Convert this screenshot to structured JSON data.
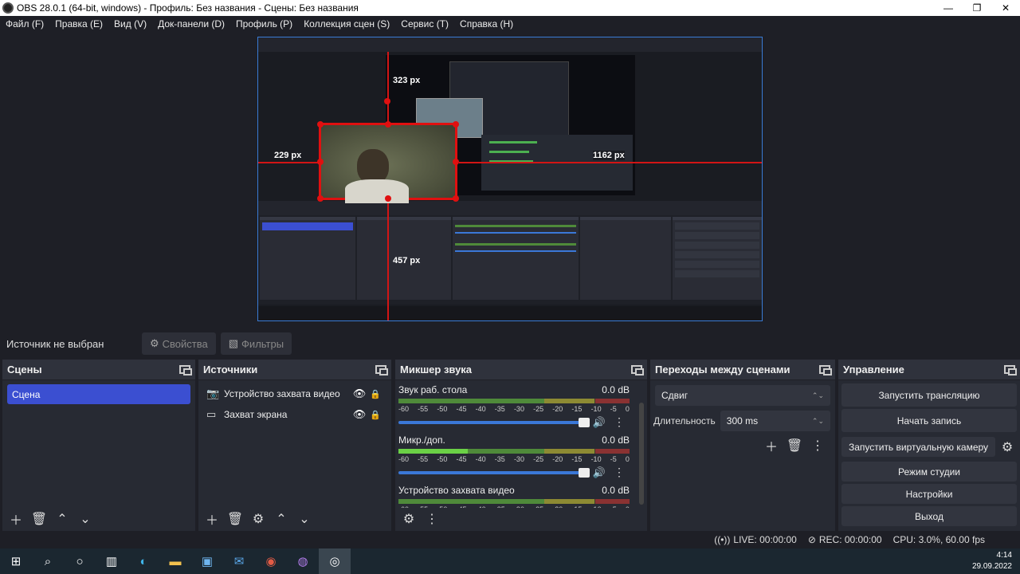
{
  "window": {
    "title": "OBS 28.0.1 (64-bit, windows) - Профиль: Без названия - Сцены: Без названия",
    "minimize": "—",
    "maximize": "❐",
    "close": "✕"
  },
  "menu": [
    "Файл (F)",
    "Правка (E)",
    "Вид (V)",
    "Док-панели (D)",
    "Профиль (P)",
    "Коллекция сцен (S)",
    "Сервис (T)",
    "Справка (H)"
  ],
  "preview": {
    "guides": {
      "top": "323 px",
      "left": "229 px",
      "right": "1162 px",
      "bottom": "457 px"
    }
  },
  "source_toolbar": {
    "no_source": "Источник не выбран",
    "properties": "Свойства",
    "filters": "Фильтры"
  },
  "scenes": {
    "title": "Сцены",
    "items": [
      "Сцена"
    ]
  },
  "sources": {
    "title": "Источники",
    "items": [
      {
        "label": "Устройство захвата видео",
        "icon": "camera-icon"
      },
      {
        "label": "Захват экрана",
        "icon": "monitor-icon"
      }
    ]
  },
  "mixer": {
    "title": "Микшер звука",
    "scale": [
      "-60",
      "-55",
      "-50",
      "-45",
      "-40",
      "-35",
      "-30",
      "-25",
      "-20",
      "-15",
      "-10",
      "-5",
      "0"
    ],
    "channels": [
      {
        "name": "Звук раб. стола",
        "db": "0.0 dB",
        "level": 0
      },
      {
        "name": "Микр./доп.",
        "db": "0.0 dB",
        "level": 0.3
      },
      {
        "name": "Устройство захвата видео",
        "db": "0.0 dB",
        "level": 0
      }
    ]
  },
  "transitions": {
    "title": "Переходы между сценами",
    "selected": "Сдвиг",
    "duration_label": "Длительность",
    "duration_value": "300 ms"
  },
  "controls": {
    "title": "Управление",
    "start_stream": "Запустить трансляцию",
    "start_record": "Начать запись",
    "virtual_cam": "Запустить виртуальную камеру",
    "studio_mode": "Режим студии",
    "settings": "Настройки",
    "exit": "Выход"
  },
  "status": {
    "live": "LIVE: 00:00:00",
    "rec": "REC: 00:00:00",
    "cpu": "CPU: 3.0%, 60.00 fps"
  },
  "taskbar": {
    "time": "4:14",
    "date": "29.09.2022"
  },
  "colors": {
    "accent": "#3b4fd1",
    "guide": "#d21515",
    "slider": "#3b78d8"
  }
}
